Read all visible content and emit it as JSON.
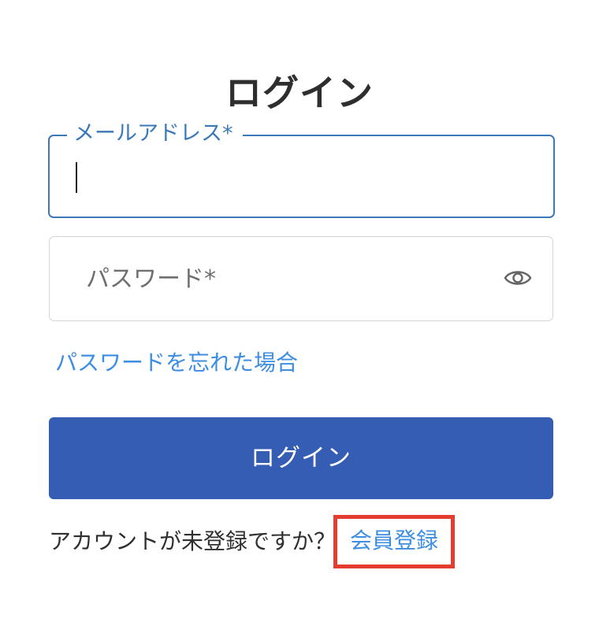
{
  "page": {
    "title": "ログイン"
  },
  "form": {
    "email": {
      "label": "メールアドレス*",
      "value": ""
    },
    "password": {
      "placeholder": "パスワード*",
      "toggle_icon": "eye-icon"
    },
    "forgot_password_link": "パスワードを忘れた場合",
    "submit_label": "ログイン"
  },
  "signup": {
    "prompt": "アカウントが未登録ですか？",
    "link_label": "会員登録",
    "highlight_color": "#e43d2f"
  },
  "colors": {
    "accent": "#3b78b8",
    "link": "#3d8de0",
    "button": "#345db3"
  }
}
